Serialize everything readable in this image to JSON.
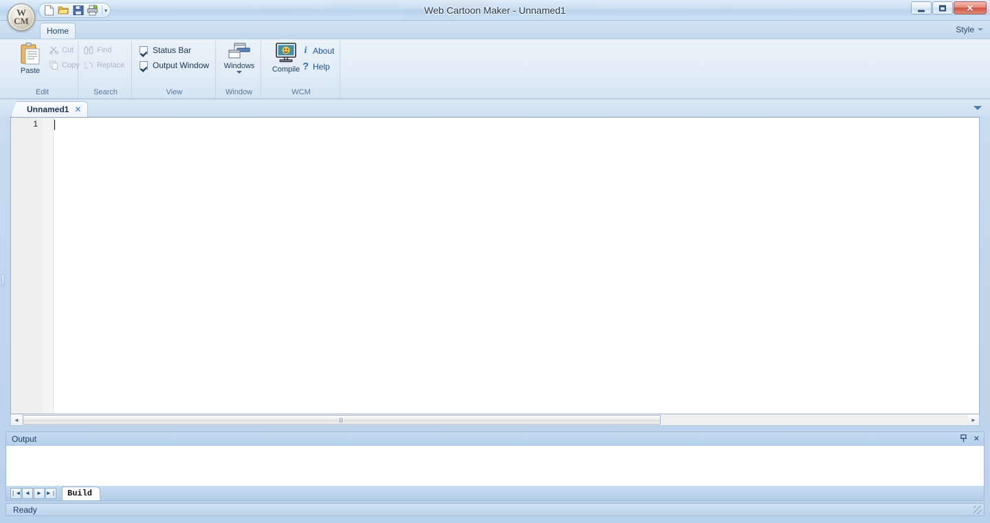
{
  "window": {
    "title": "Web Cartoon Maker - Unnamed1",
    "controls": {
      "minimize": "minimize",
      "restore": "restore",
      "close": "✕"
    }
  },
  "app_button": {
    "name": "office-orb",
    "letter_top": "W",
    "letter_bottom": "CM"
  },
  "quick_access": {
    "items": [
      {
        "name": "new-document-icon",
        "label": "New"
      },
      {
        "name": "open-folder-icon",
        "label": "Open"
      },
      {
        "name": "save-disk-icon",
        "label": "Save"
      },
      {
        "name": "print-icon",
        "label": "Print"
      }
    ],
    "customize_label": "▾"
  },
  "ribbon": {
    "tabs": [
      {
        "label": "Home",
        "active": true
      }
    ],
    "style_menu": {
      "label": "Style"
    },
    "groups": [
      {
        "title": "Edit",
        "items": [
          {
            "name": "paste-button",
            "label": "Paste",
            "enabled": true
          },
          {
            "name": "cut-button",
            "label": "Cut",
            "enabled": false
          },
          {
            "name": "copy-button",
            "label": "Copy",
            "enabled": false
          }
        ]
      },
      {
        "title": "Search",
        "items": [
          {
            "name": "find-button",
            "label": "Find",
            "enabled": false
          },
          {
            "name": "replace-button",
            "label": "Replace",
            "enabled": false
          }
        ]
      },
      {
        "title": "View",
        "items": [
          {
            "name": "status-bar-checkbox",
            "label": "Status Bar",
            "checked": true
          },
          {
            "name": "output-window-checkbox",
            "label": "Output Window",
            "checked": true
          }
        ]
      },
      {
        "title": "Window",
        "items": [
          {
            "name": "windows-button",
            "label": "Windows",
            "has_dropdown": true
          }
        ]
      },
      {
        "title": "WCM",
        "items": [
          {
            "name": "compile-button",
            "label": "Compile"
          },
          {
            "name": "about-button",
            "label": "About",
            "glyph": "i"
          },
          {
            "name": "help-button",
            "label": "Help",
            "glyph": "?"
          }
        ]
      }
    ]
  },
  "document_tabs": {
    "tabs": [
      {
        "label": "Unnamed1",
        "close": "✕",
        "active": true
      }
    ],
    "list_dropdown": "▾"
  },
  "editor": {
    "line_numbers": [
      "1"
    ],
    "content": "",
    "scrollbar": {
      "left_arrow": "◄",
      "right_arrow": "►"
    }
  },
  "output_panel": {
    "title": "Output",
    "pin_icon": "⍠",
    "close_icon": "✕",
    "content": "",
    "nav_buttons": [
      {
        "name": "first-button",
        "glyph": "❘◄"
      },
      {
        "name": "previous-button",
        "glyph": "◄"
      },
      {
        "name": "next-button",
        "glyph": "►"
      },
      {
        "name": "last-button",
        "glyph": "►❘"
      }
    ],
    "tabs": [
      {
        "label": "Build",
        "active": true
      }
    ]
  },
  "status_bar": {
    "text": "Ready"
  },
  "colors": {
    "accent": "#1f4f8f",
    "ribbon_bg": "#e3edf7",
    "title_text": "#26364a",
    "close_button": "#d2503d"
  }
}
